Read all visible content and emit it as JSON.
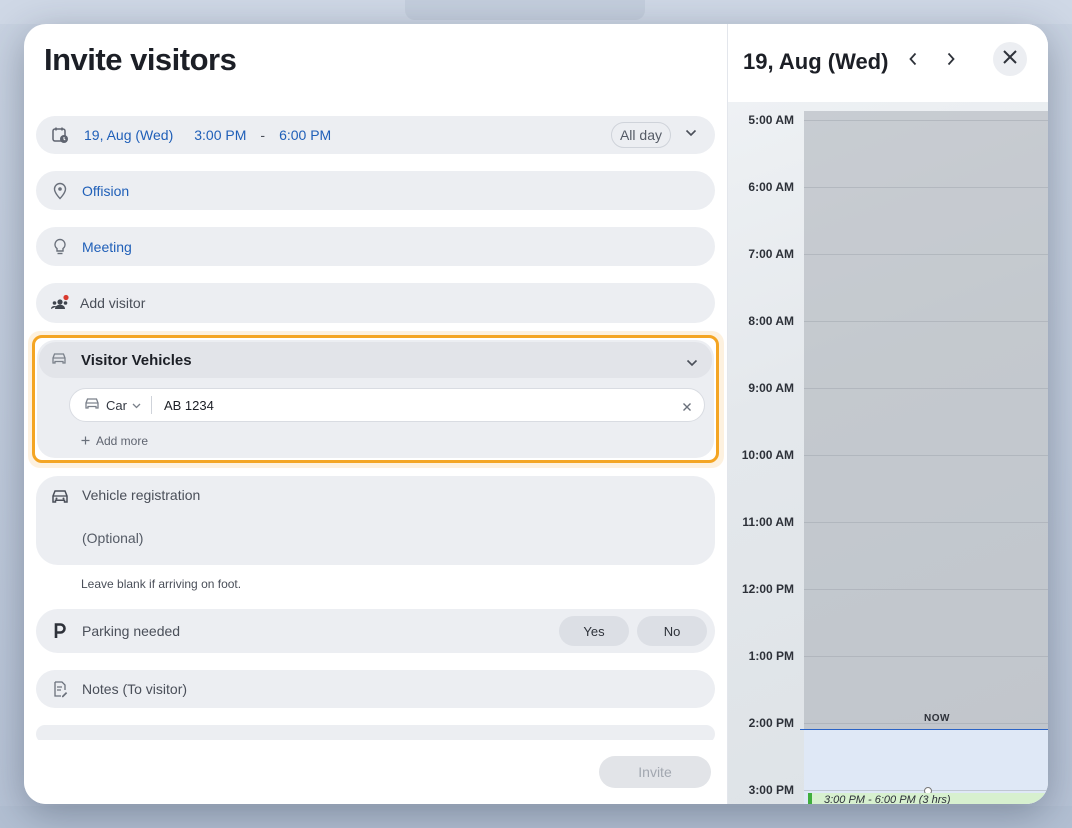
{
  "modal": {
    "title": "Invite visitors",
    "invite_label": "Invite"
  },
  "date_row": {
    "icon": "calendar-clock-icon",
    "date": "19, Aug (Wed)",
    "start_time": "3:00 PM",
    "separator": "-",
    "end_time": "6:00 PM",
    "all_day_label": "All day"
  },
  "location": {
    "icon": "location-pin-icon",
    "value": "Offision"
  },
  "purpose": {
    "icon": "lightbulb-icon",
    "value": "Meeting"
  },
  "visitor": {
    "icon": "people-icon",
    "placeholder": "Add visitor"
  },
  "vehicles": {
    "header": "Visitor Vehicles",
    "items": [
      {
        "type": "Car",
        "plate": "AB 1234"
      }
    ],
    "add_more_label": "Add more"
  },
  "registration": {
    "label": "Vehicle registration",
    "placeholder": "(Optional)",
    "hint": "Leave blank if arriving on foot."
  },
  "parking": {
    "label": "Parking needed",
    "yes_label": "Yes",
    "no_label": "No"
  },
  "notes": {
    "placeholder": "Notes (To visitor)"
  },
  "calendar": {
    "date": "19, Aug (Wed)",
    "hours": [
      "5:00 AM",
      "6:00 AM",
      "7:00 AM",
      "8:00 AM",
      "9:00 AM",
      "10:00 AM",
      "11:00 AM",
      "12:00 PM",
      "1:00 PM",
      "2:00 PM",
      "3:00 PM"
    ],
    "now_label": "NOW",
    "event_label": "3:00 PM - 6:00 PM (3 hrs)"
  },
  "colors": {
    "accent_blue": "#1f5fb8",
    "highlight_orange": "#f4a523",
    "event_green": "#3fae3c",
    "now_line": "#2a63c6"
  }
}
